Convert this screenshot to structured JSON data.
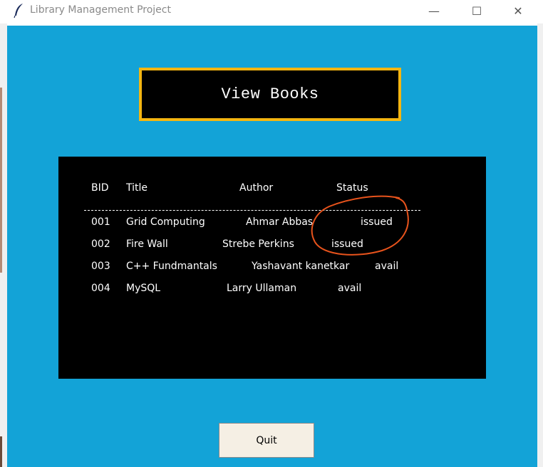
{
  "window": {
    "title": "Library Management Project",
    "minimize": "—",
    "maximize": "☐",
    "close": "✕"
  },
  "heading": "View Books",
  "table": {
    "headers": {
      "bid": "BID",
      "title": "Title",
      "author": "Author",
      "status": "Status"
    },
    "rows": [
      {
        "bid": "001",
        "title": "Grid Computing",
        "author": "Ahmar Abbas",
        "status": "issued"
      },
      {
        "bid": "002",
        "title": "Fire Wall",
        "author": "Strebe Perkins",
        "status": "issued"
      },
      {
        "bid": "003",
        "title": "C++ Fundmantals",
        "author": "Yashavant kanetkar",
        "status": "avail"
      },
      {
        "bid": "004",
        "title": "MySQL",
        "author": "Larry Ullaman",
        "status": "avail"
      }
    ]
  },
  "quit_label": "Quit",
  "colors": {
    "background": "#13a3d7",
    "heading_border": "#f4b511",
    "annotation": "#e8531c"
  }
}
